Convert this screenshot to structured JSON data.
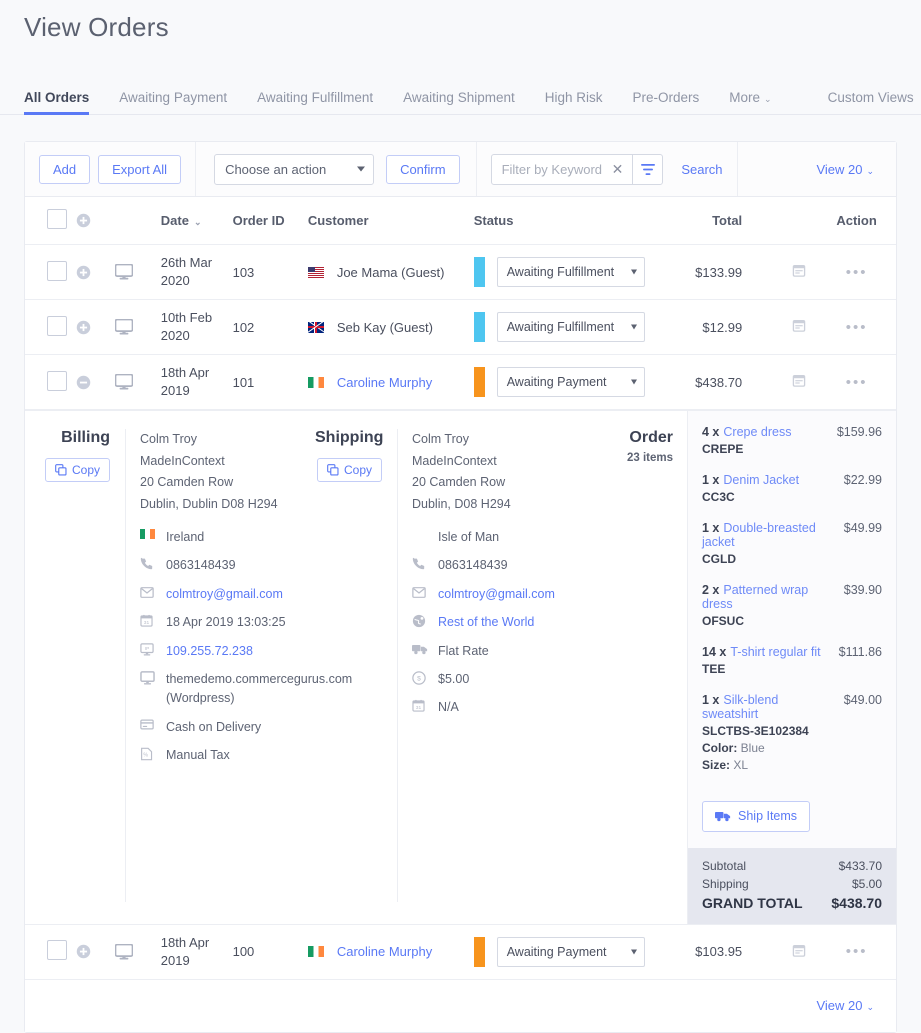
{
  "page": {
    "title": "View Orders"
  },
  "tabs": [
    {
      "label": "All Orders",
      "active": true
    },
    {
      "label": "Awaiting Payment",
      "active": false
    },
    {
      "label": "Awaiting Fulfillment",
      "active": false
    },
    {
      "label": "Awaiting Shipment",
      "active": false
    },
    {
      "label": "High Risk",
      "active": false
    },
    {
      "label": "Pre-Orders",
      "active": false
    },
    {
      "label": "More",
      "active": false,
      "caret": "⌄"
    },
    {
      "label": "Custom Views",
      "active": false
    }
  ],
  "toolbar": {
    "add_label": "Add",
    "export_label": "Export All",
    "action_select_value": "Choose an action",
    "confirm_label": "Confirm",
    "filter_placeholder": "Filter by Keyword",
    "filter_value": "",
    "filter_clear": "✕",
    "search_label": "Search",
    "view_label": "View 20",
    "view_caret": "⌄"
  },
  "table": {
    "headers": {
      "date": "Date",
      "sort_caret": "⌄",
      "order_id": "Order ID",
      "customer": "Customer",
      "status": "Status",
      "total": "Total",
      "action": "Action"
    },
    "rows": [
      {
        "expander": "plus",
        "device": "desktop-icon",
        "date": "26th Mar 2020",
        "order_id": "103",
        "flag": "us",
        "customer": "Joe Mama (Guest)",
        "customer_is_link": false,
        "status": "Awaiting Fulfillment",
        "status_color": "#4ec6f0",
        "total": "$133.99"
      },
      {
        "expander": "plus",
        "device": "desktop-icon",
        "date": "10th Feb 2020",
        "order_id": "102",
        "flag": "uk",
        "customer": "Seb Kay (Guest)",
        "customer_is_link": false,
        "status": "Awaiting Fulfillment",
        "status_color": "#4ec6f0",
        "total": "$12.99"
      },
      {
        "expander": "minus",
        "device": "desktop-icon",
        "date": "18th Apr 2019",
        "order_id": "101",
        "flag": "ie",
        "customer": "Caroline Murphy",
        "customer_is_link": true,
        "status": "Awaiting Payment",
        "status_color": "#f7941d",
        "total": "$438.70",
        "expanded": true
      },
      {
        "expander": "plus",
        "device": "desktop-icon",
        "date": "18th Apr 2019",
        "order_id": "100",
        "flag": "ie",
        "customer": "Caroline Murphy",
        "customer_is_link": true,
        "status": "Awaiting Payment",
        "status_color": "#f7941d",
        "total": "$103.95"
      }
    ]
  },
  "detail": {
    "billing": {
      "heading": "Billing",
      "copy_label": "Copy",
      "address": "Colm Troy\nMadeInContext\n20 Camden Row\nDublin, Dublin D08 H294",
      "fields": [
        {
          "icon": "flag-ie-icon",
          "value": "Ireland",
          "link": false
        },
        {
          "icon": "phone-icon",
          "value": "0863148439",
          "link": false
        },
        {
          "icon": "envelope-icon",
          "value": "colmtroy@gmail.com",
          "link": true
        },
        {
          "icon": "calendar-icon",
          "value": "18 Apr 2019 13:03:25",
          "link": false
        },
        {
          "icon": "ip-monitor-icon",
          "value": "109.255.72.238",
          "link": true
        },
        {
          "icon": "monitor-icon",
          "value": "themedemo.commercegurus.com (Wordpress)",
          "link": false
        },
        {
          "icon": "credit-card-icon",
          "value": "Cash on Delivery",
          "link": false
        },
        {
          "icon": "percent-tax-icon",
          "value": "Manual Tax",
          "link": false
        }
      ]
    },
    "shipping": {
      "heading": "Shipping",
      "copy_label": "Copy",
      "address": "Colm Troy\nMadeInContext\n20 Camden Row\nDublin, D08 H294",
      "fields": [
        {
          "icon": "none-icon",
          "value": "Isle of Man",
          "link": false
        },
        {
          "icon": "phone-icon",
          "value": "0863148439",
          "link": false
        },
        {
          "icon": "envelope-icon",
          "value": "colmtroy@gmail.com",
          "link": true
        },
        {
          "icon": "globe-icon",
          "value": "Rest of the World",
          "link": true
        },
        {
          "icon": "truck-icon",
          "value": "Flat Rate",
          "link": false
        },
        {
          "icon": "dollar-circle-icon",
          "value": "$5.00",
          "link": false
        },
        {
          "icon": "calendar-icon",
          "value": "N/A",
          "link": false
        }
      ]
    },
    "order": {
      "heading": "Order",
      "items_count": "23 items",
      "items": [
        {
          "qty": "4 x",
          "name": "Crepe dress",
          "price": "$159.96",
          "sku": "CREPE",
          "options": []
        },
        {
          "qty": "1 x",
          "name": "Denim Jacket",
          "price": "$22.99",
          "sku": "CC3C",
          "options": []
        },
        {
          "qty": "1 x",
          "name": "Double-breasted jacket",
          "price": "$49.99",
          "sku": "CGLD",
          "options": []
        },
        {
          "qty": "2 x",
          "name": "Patterned wrap dress",
          "price": "$39.90",
          "sku": "OFSUC",
          "options": []
        },
        {
          "qty": "14 x",
          "name": "T-shirt regular fit",
          "price": "$111.86",
          "sku": "TEE",
          "options": []
        },
        {
          "qty": "1 x",
          "name": "Silk-blend sweatshirt",
          "price": "$49.00",
          "sku": "SLCTBS-3E102384",
          "options": [
            {
              "label": "Color:",
              "value": "Blue"
            },
            {
              "label": "Size:",
              "value": "XL"
            }
          ]
        }
      ],
      "ship_items_label": "Ship Items",
      "totals": [
        {
          "label": "Subtotal",
          "amount": "$433.70",
          "grand": false
        },
        {
          "label": "Shipping",
          "amount": "$5.00",
          "grand": false
        },
        {
          "label": "GRAND TOTAL",
          "amount": "$438.70",
          "grand": true
        }
      ]
    }
  },
  "footer": {
    "view_label": "View 20",
    "view_caret": "⌄"
  },
  "colors": {
    "accent": "#5a79f5",
    "status_awaiting_fulfillment": "#4ec6f0",
    "status_awaiting_payment": "#f7941d",
    "totals_bg": "#e5e7ef"
  }
}
